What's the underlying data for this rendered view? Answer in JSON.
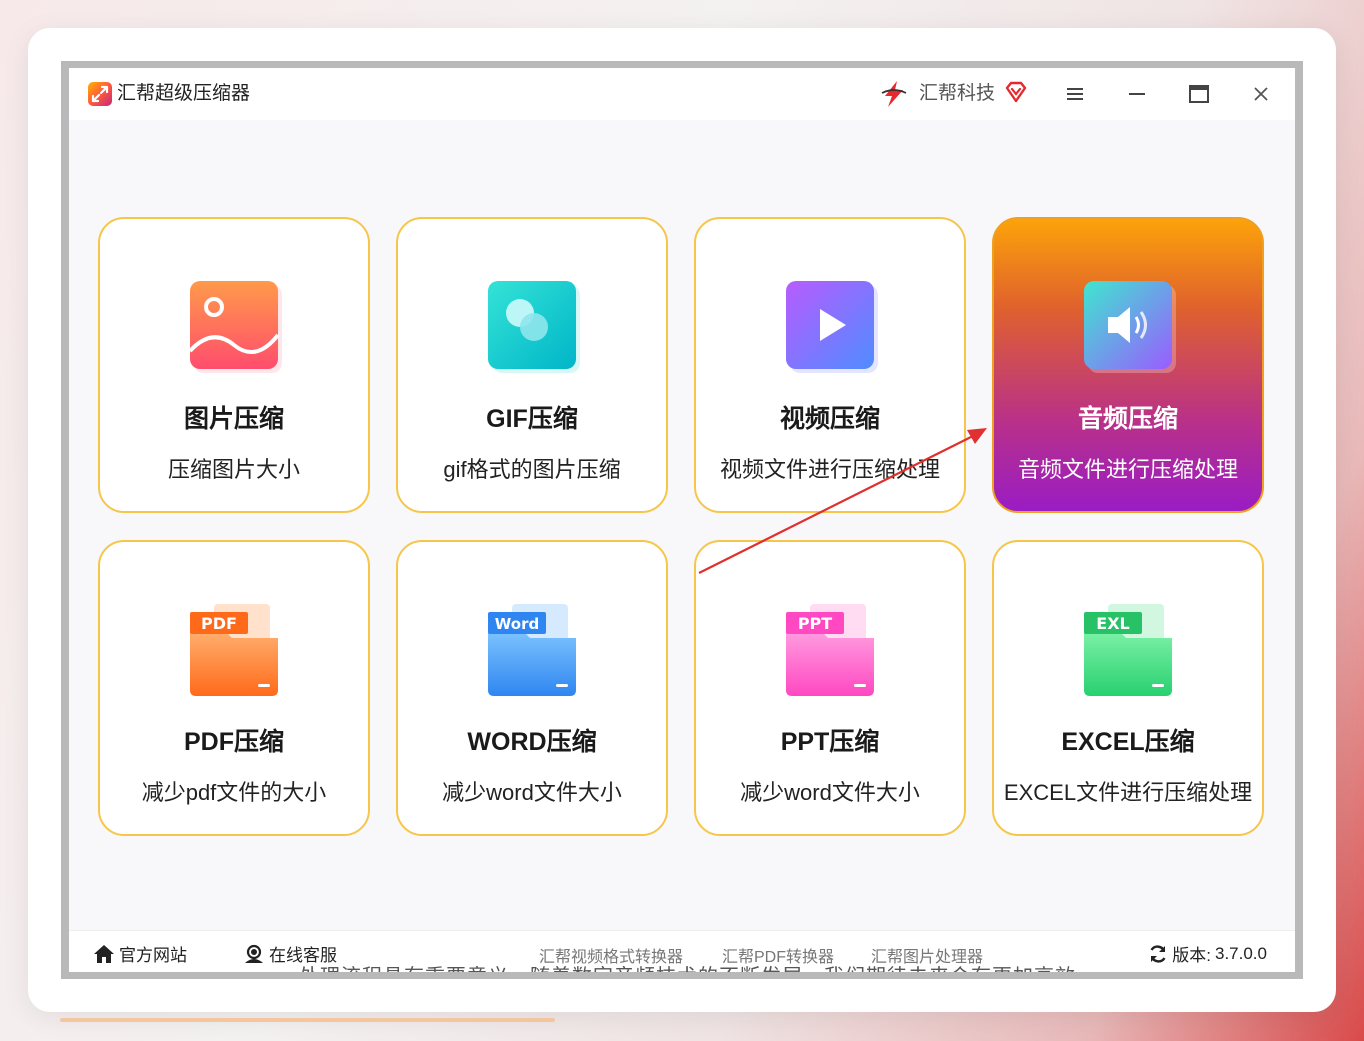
{
  "window": {
    "title": "汇帮超级压缩器",
    "brand": "汇帮科技"
  },
  "cards": [
    {
      "title": "图片压缩",
      "desc": "压缩图片大小",
      "icon": "image-icon"
    },
    {
      "title": "GIF压缩",
      "desc": "gif格式的图片压缩",
      "icon": "gif-icon"
    },
    {
      "title": "视频压缩",
      "desc": "视频文件进行压缩处理",
      "icon": "video-play-icon"
    },
    {
      "title": "音频压缩",
      "desc": "音频文件进行压缩处理",
      "icon": "audio-speaker-icon",
      "active": true
    },
    {
      "title": "PDF压缩",
      "desc": "减少pdf文件的大小",
      "icon": "pdf-folder-icon",
      "badge": "PDF"
    },
    {
      "title": "WORD压缩",
      "desc": "减少word文件大小",
      "icon": "word-folder-icon",
      "badge": "Word"
    },
    {
      "title": "PPT压缩",
      "desc": "减少word文件大小",
      "icon": "ppt-folder-icon",
      "badge": "PPT"
    },
    {
      "title": "EXCEL压缩",
      "desc": "EXCEL文件进行压缩处理",
      "icon": "excel-folder-icon",
      "badge": "EXL"
    }
  ],
  "footer": {
    "website": "官方网站",
    "support": "在线客服",
    "apps": [
      "汇帮视频格式转换器",
      "汇帮PDF转换器",
      "汇帮图片处理器"
    ],
    "version_label": "版本:",
    "version": "3.7.0.0"
  },
  "background_text": "处理流程具有重要意义。随着数字音频技术的不断发展，我们期待未来会有更加高效",
  "colors": {
    "card_border": "#f5c64a",
    "active_gradient_top": "#fca30a",
    "active_gradient_bottom": "#9a1cc4",
    "arrow": "#e03030"
  }
}
